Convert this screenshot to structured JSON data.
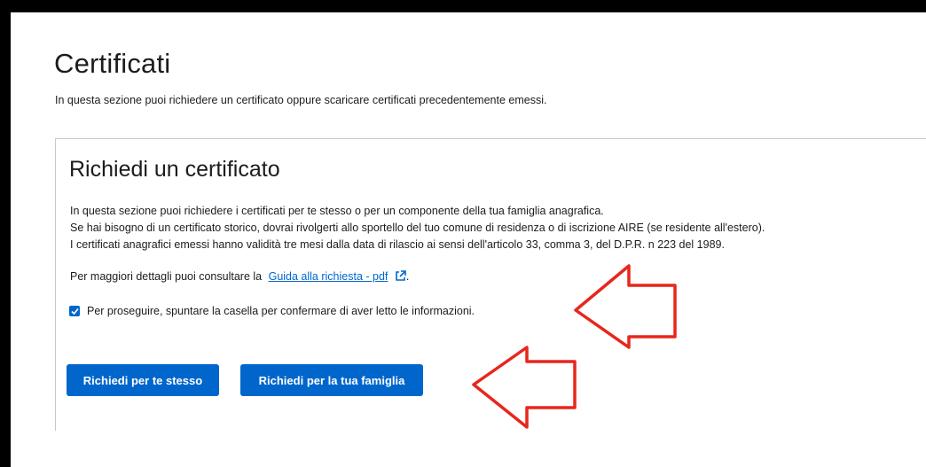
{
  "page": {
    "title": "Certificati",
    "intro": "In questa sezione puoi richiedere un certificato oppure scaricare certificati precedentemente emessi."
  },
  "request_card": {
    "title": "Richiedi un certificato",
    "paragraphs": [
      "In questa sezione puoi richiedere i certificati per te stesso o per un componente della tua famiglia anagrafica.",
      "Se hai bisogno di un certificato storico, dovrai rivolgerti allo sportello del tuo comune di residenza o di iscrizione AIRE (se residente all'estero).",
      "I certificati anagrafici emessi hanno validità tre mesi dalla data di rilascio ai sensi dell'articolo 33, comma 3, del D.P.R. n 223 del 1989."
    ],
    "guide_prefix": "Per maggiori dettagli puoi consultare la",
    "guide_link": "Guida alla richiesta - pdf",
    "guide_suffix": ".",
    "confirm_checked": true,
    "confirm_label": "Per proseguire, spuntare la casella per confermare di aver letto le informazioni.",
    "buttons": {
      "self": "Richiedi per te stesso",
      "family": "Richiedi per la tua famiglia"
    }
  },
  "icons": {
    "external_link": "external-link-icon",
    "checkbox_check": "checkmark-icon",
    "annotation_arrow": "red-arrow-icon"
  },
  "colors": {
    "primary": "#0066cc",
    "annotation": "#e8261c",
    "frame": "#000000"
  }
}
